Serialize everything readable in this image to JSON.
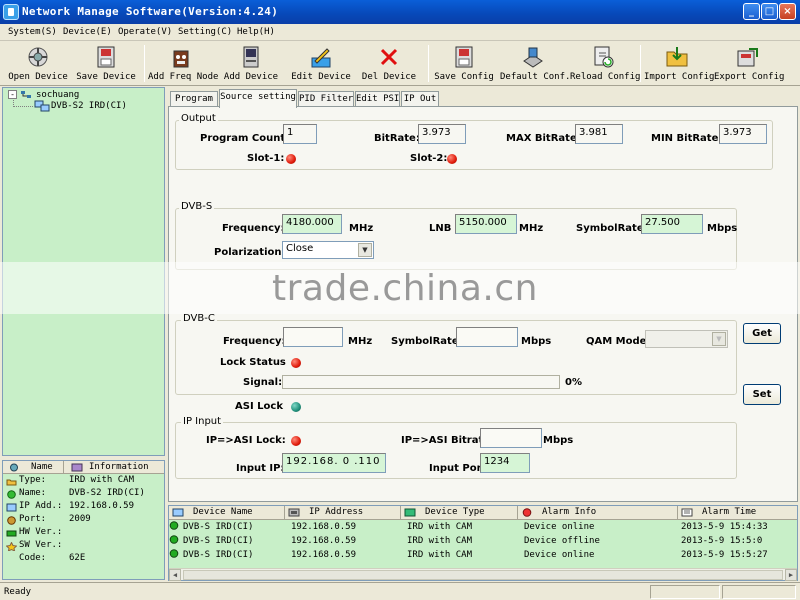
{
  "window": {
    "title": "Network Manage Software(Version:4.24)",
    "minimize": "_",
    "maximize": "□",
    "close": "×"
  },
  "menu": {
    "items": [
      {
        "label": "System(S)"
      },
      {
        "label": "Device(E)"
      },
      {
        "label": "Operate(V)"
      },
      {
        "label": "Setting(C)"
      },
      {
        "label": "Help(H)"
      }
    ]
  },
  "toolbar": {
    "open_device": "Open Device",
    "save_device": "Save Device",
    "add_freq_node": "Add Freq Node",
    "add_device": "Add Device",
    "edit_device": "Edit Device",
    "del_device": "Del Device",
    "save_config": "Save Config",
    "default_conf": "Default Conf.",
    "reload_config": "Reload Config",
    "import_config": "Import Config",
    "export_config": "Export Config"
  },
  "tree": {
    "root": "sochuang",
    "child": "DVB-S2 IRD(CI)",
    "expander": "-"
  },
  "info": {
    "headers": {
      "name": "Name",
      "information": "Information"
    },
    "rows": [
      {
        "key": "Type:",
        "value": "IRD with CAM"
      },
      {
        "key": "Name:",
        "value": "DVB-S2 IRD(CI)"
      },
      {
        "key": "IP Add.:",
        "value": "192.168.0.59"
      },
      {
        "key": "Port:",
        "value": "2009"
      },
      {
        "key": "HW Ver.:",
        "value": ""
      },
      {
        "key": "SW Ver.:",
        "value": ""
      },
      {
        "key": "Code:",
        "value": "62E"
      }
    ]
  },
  "tabs": [
    {
      "label": "Program"
    },
    {
      "label": "Source setting"
    },
    {
      "label": "PID Filter"
    },
    {
      "label": "Edit PSI"
    },
    {
      "label": "IP Out"
    }
  ],
  "output": {
    "title": "Output",
    "program_count_label": "Program Count:",
    "program_count": "1",
    "bitrate_label": "BitRate:",
    "bitrate": "3.973",
    "max_bitrate_label": "MAX BitRate:",
    "max_bitrate": "3.981",
    "min_bitrate_label": "MIN BitRate:",
    "min_bitrate": "3.973",
    "slot1_label": "Slot-1:",
    "slot2_label": "Slot-2:"
  },
  "dvbs": {
    "title": "DVB-S",
    "frequency_label": "Frequency:",
    "frequency": "4180.000",
    "freq_unit": "MHz",
    "lnb_label": "LNB",
    "lnb": "5150.000",
    "lnb_unit": "MHz",
    "symbolrate_label": "SymbolRate:",
    "symbolrate": "27.500",
    "symbolrate_unit": "Mbps",
    "polarization_label": "Polarization:",
    "polarization": "Close",
    "dropdown_arrow": "▼"
  },
  "dvbc": {
    "title": "DVB-C",
    "frequency_label": "Frequency:",
    "frequency": "",
    "freq_unit": "MHz",
    "symbolrate_label": "SymbolRate:",
    "symbolrate": "",
    "symbolrate_unit": "Mbps",
    "qam_label": "QAM Mode:",
    "qam": "",
    "lock_status_label": "Lock Status",
    "signal_label": "Signal:",
    "signal_percent": "0%",
    "signal_fraction": 0
  },
  "asi": {
    "lock_label": "ASI Lock"
  },
  "ip_input": {
    "title": "IP Input",
    "lock_label": "IP=>ASI Lock:",
    "bitrate_label": "IP=>ASI Bitrate:",
    "bitrate": "",
    "bitrate_unit": "Mbps",
    "input_ip_label": "Input IP:",
    "input_ip": "192.168. 0 .110",
    "input_port_label": "Input Port:",
    "input_port": "1234"
  },
  "buttons": {
    "get": "Get",
    "set": "Set"
  },
  "alarm": {
    "headers": {
      "device_name": "Device Name",
      "ip_address": "IP Address",
      "device_type": "Device Type",
      "alarm_info": "Alarm Info",
      "alarm_time": "Alarm Time"
    },
    "rows": [
      {
        "name": "DVB-S IRD(CI)",
        "ip": "192.168.0.59",
        "type": "IRD with CAM",
        "info": "Device online",
        "time": "2013-5-9 15:4:33"
      },
      {
        "name": "DVB-S IRD(CI)",
        "ip": "192.168.0.59",
        "type": "IRD with CAM",
        "info": "Device offline",
        "time": "2013-5-9 15:5:0"
      },
      {
        "name": "DVB-S IRD(CI)",
        "ip": "192.168.0.59",
        "type": "IRD with CAM",
        "info": "Device online",
        "time": "2013-5-9 15:5:27"
      }
    ],
    "scroll_left": "◀",
    "scroll_right": "▶"
  },
  "status": {
    "text": "Ready"
  },
  "watermark": {
    "text": "trade.china.cn"
  },
  "colors": {
    "titlebar": "#0748b8",
    "pane_green": "#c8efc8",
    "led_red": "#e01a0a",
    "led_teal": "#1f8f7a",
    "field_green": "#d6f5d6"
  }
}
